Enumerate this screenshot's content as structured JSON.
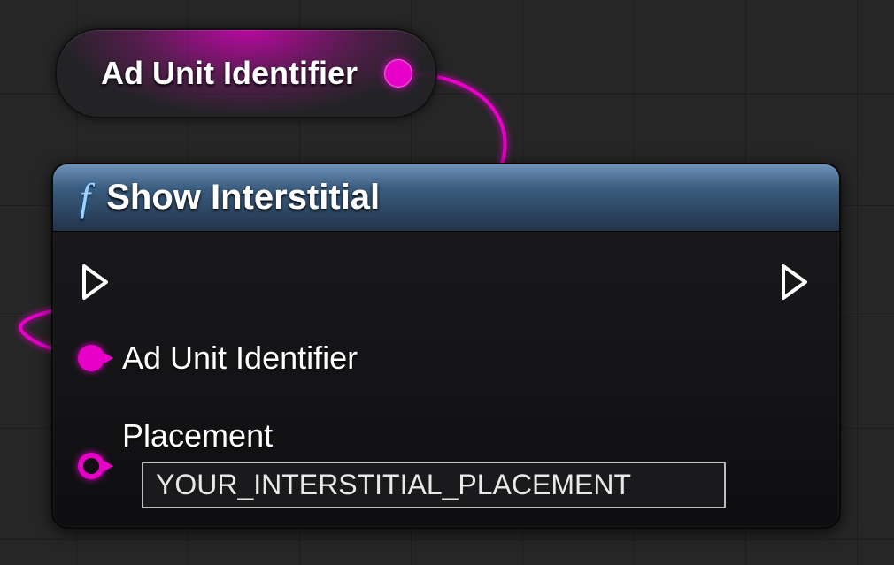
{
  "variable_node": {
    "label": "Ad Unit Identifier",
    "pin_color": "#e600c8"
  },
  "function_node": {
    "icon_glyph": "f",
    "title": "Show Interstitial",
    "inputs": {
      "ad_unit_identifier": {
        "label": "Ad Unit Identifier",
        "connected": true
      },
      "placement": {
        "label": "Placement",
        "value": "YOUR_INTERSTITIAL_PLACEMENT",
        "connected": false
      }
    }
  }
}
